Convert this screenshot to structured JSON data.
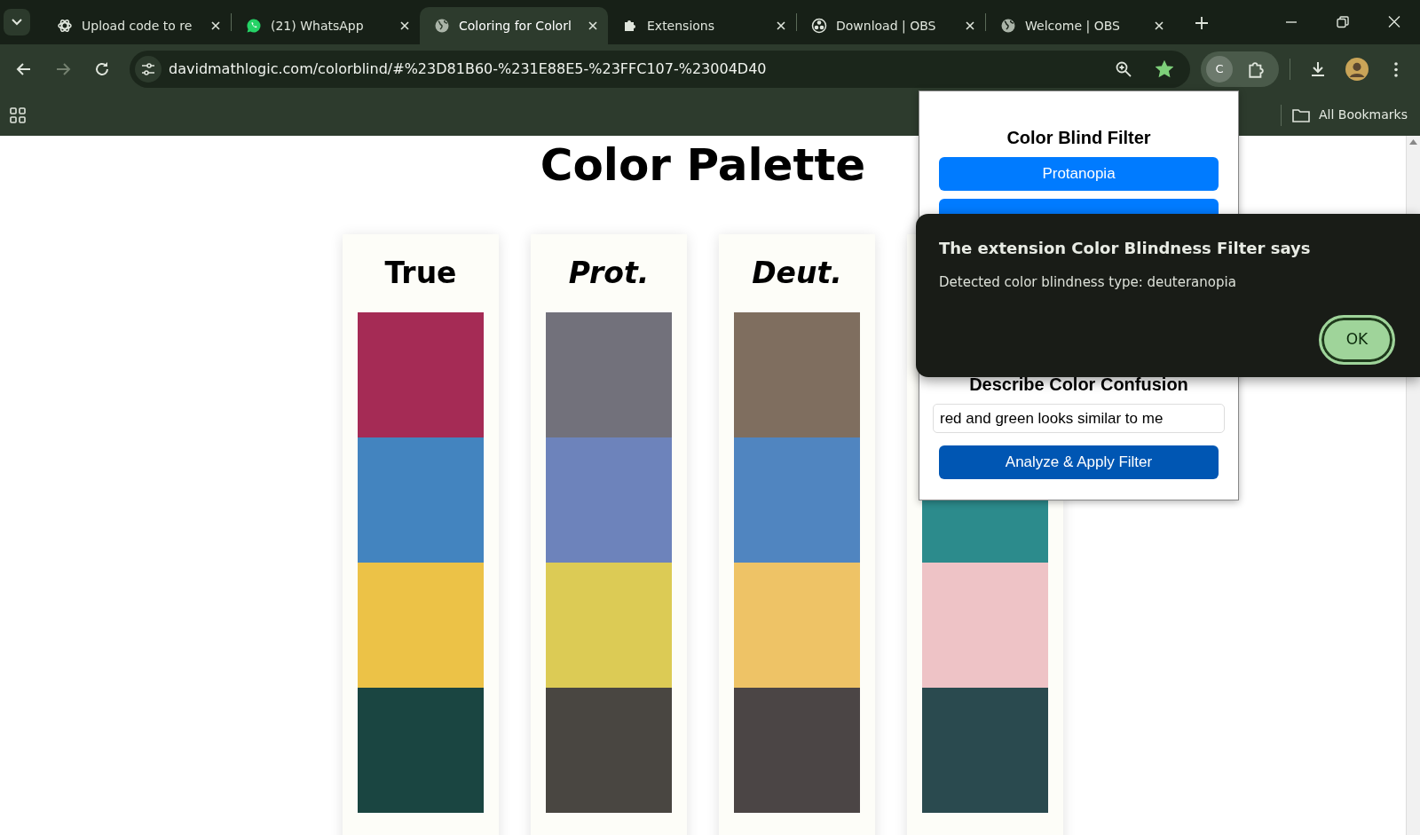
{
  "browser": {
    "tabs": [
      {
        "title": "Upload code to re",
        "selected": false
      },
      {
        "title": "(21) WhatsApp",
        "selected": false
      },
      {
        "title": "Coloring for Colorl",
        "selected": true
      },
      {
        "title": "Extensions",
        "selected": false
      },
      {
        "title": "Download | OBS",
        "selected": false
      },
      {
        "title": "Welcome | OBS",
        "selected": false
      }
    ],
    "address": "davidmathlogic.com/colorblind/#%23D81B60-%231E88E5-%23FFC107-%23004D40",
    "bookmarked": true,
    "extension_letter": "C",
    "bookmarks": [
      "All Bookmarks"
    ]
  },
  "page": {
    "title": "Color Palette",
    "palettes": [
      {
        "label": "True",
        "italic": false,
        "swatches": [
          {
            "color": "#a52b55"
          },
          {
            "color": "#4384bf"
          },
          {
            "color": "#ecc247"
          },
          {
            "color": "#1a4541"
          }
        ]
      },
      {
        "label": "Prot.",
        "italic": true,
        "swatches": [
          {
            "color": "#72717b"
          },
          {
            "color": "#6d83bb"
          },
          {
            "color": "#dccb55"
          },
          {
            "color": "#494641"
          }
        ]
      },
      {
        "label": "Deut.",
        "italic": true,
        "swatches": [
          {
            "color": "#7f6e5f"
          },
          {
            "color": "#5085c0"
          },
          {
            "color": "#eec366"
          },
          {
            "color": "#4b4545"
          }
        ]
      },
      {
        "swatches": [
          {
            "color": "#2c8b8c"
          },
          {
            "color": "#eec3c6"
          },
          {
            "color": "#2a4a4f"
          }
        ]
      }
    ]
  },
  "extension_popup": {
    "title": "Color Blind Filter",
    "filter_buttons": [
      "Protanopia"
    ],
    "section_title": "Describe Color Confusion",
    "input_value": "red and green looks similar to me",
    "apply_button": "Analyze & Apply Filter"
  },
  "dialog": {
    "title": "The extension Color Blindness Filter says",
    "message": "Detected color blindness type: deuteranopia",
    "ok_button": "OK"
  }
}
